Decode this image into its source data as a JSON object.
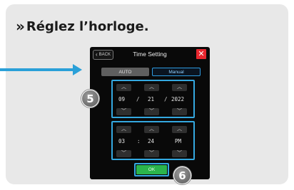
{
  "heading": {
    "chevron": "»",
    "text": "Réglez l’horloge."
  },
  "colors": {
    "accent": "#34a8e0",
    "card": "#e8e8e8",
    "close": "#e8262e",
    "ok": "#2bb54b"
  },
  "screen": {
    "back_label": "BACK",
    "back_icon": "‹",
    "title": "Time Setting",
    "close_glyph": "✕",
    "tabs": [
      {
        "label": "AUTO",
        "selected": false
      },
      {
        "label": "Manual",
        "selected": true
      }
    ],
    "date": {
      "month": "09",
      "day": "21",
      "year": "2022",
      "separator": "/"
    },
    "time": {
      "hour": "03",
      "minute": "24",
      "meridiem": "PM",
      "separator": ":"
    },
    "up_glyph": "︿",
    "down_glyph": "﹀",
    "ok_label": "OK"
  },
  "callouts": {
    "step_5": "5",
    "step_6": "6"
  }
}
